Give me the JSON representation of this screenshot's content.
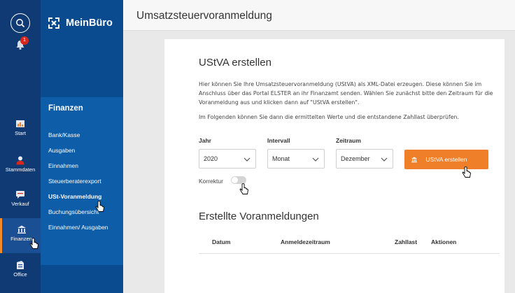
{
  "app": {
    "brand": "MeinBüro"
  },
  "rail": {
    "notification_count": "1",
    "items": [
      {
        "label": "Start",
        "icon": "bar-chart-icon"
      },
      {
        "label": "Stammdaten",
        "icon": "person-icon"
      },
      {
        "label": "Verkauf",
        "icon": "chat-icon"
      },
      {
        "label": "Finanzen",
        "icon": "bank-icon",
        "active": true
      },
      {
        "label": "Office",
        "icon": "office-icon"
      }
    ]
  },
  "nav": {
    "section_title": "Finanzen",
    "items": [
      "Bank/Kasse",
      "Ausgaben",
      "Einnahmen",
      "Steuerberaterexport",
      "USt-Voranmeldung",
      "Buchungsübersicht",
      "Einnahmen/ Ausgaben"
    ]
  },
  "header": {
    "title": "Umsatzsteuervoranmeldung"
  },
  "create": {
    "title": "UStVA erstellen",
    "description": "Hier können Sie Ihre Umsatzsteuervoranmeldung (UStVA) als XML-Datei erzeugen. Diese können Sie im Anschluss über das Portal ELSTER an ihr Finanzamt senden. Wählen Sie zunächst bitte den Zeitraum für die Voranmeldung aus und klicken dann auf \"UStVA erstellen\".",
    "description2": "Im Folgenden können Sie dann die ermittelten Werte und die entstandene Zahllast überprüfen.",
    "fields": {
      "jahr": {
        "label": "Jahr",
        "value": "2020"
      },
      "intervall": {
        "label": "Intervall",
        "value": "Monat"
      },
      "zeitraum": {
        "label": "Zeitraum",
        "value": "Dezember"
      }
    },
    "button_label": "UStVA erstellen",
    "korrektur_label": "Korrektur",
    "korrektur_on": false
  },
  "list": {
    "title": "Erstellte Voranmeldungen",
    "columns": [
      "Datum",
      "Anmeldezeitraum",
      "Zahllast",
      "Aktionen"
    ]
  },
  "colors": {
    "rail_bg": "#0f3a73",
    "nav_bg": "#0a4a8e",
    "nav_section_bg": "#0d5da8",
    "accent": "#f07f2a",
    "badge": "#d9261c"
  }
}
